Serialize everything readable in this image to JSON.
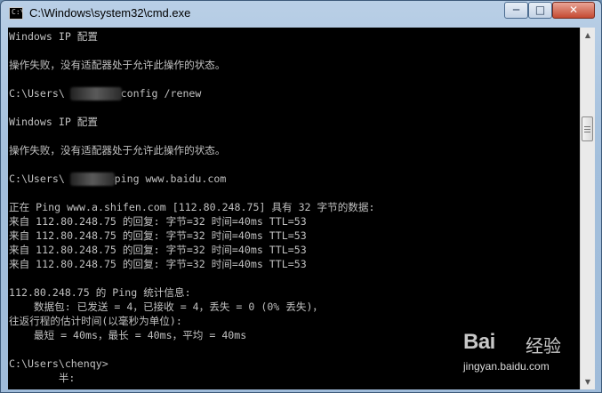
{
  "window": {
    "title": "C:\\Windows\\system32\\cmd.exe",
    "icon_glyph": "C:\\",
    "controls": {
      "minimize": "─",
      "maximize": "□",
      "close": "✕"
    }
  },
  "console": {
    "lines": [
      "Windows IP 配置",
      "",
      "操作失败，没有适配器处于允许此操作的状态。",
      "",
      "C:\\Users\\      >ipconfig /renew",
      "",
      "Windows IP 配置",
      "",
      "操作失败，没有适配器处于允许此操作的状态。",
      "",
      "C:\\Users\\      y>ping www.baidu.com",
      "",
      "正在 Ping www.a.shifen.com [112.80.248.75] 具有 32 字节的数据:",
      "来自 112.80.248.75 的回复: 字节=32 时间=40ms TTL=53",
      "来自 112.80.248.75 的回复: 字节=32 时间=40ms TTL=53",
      "来自 112.80.248.75 的回复: 字节=32 时间=40ms TTL=53",
      "来自 112.80.248.75 的回复: 字节=32 时间=40ms TTL=53",
      "",
      "112.80.248.75 的 Ping 统计信息:",
      "    数据包: 已发送 = 4，已接收 = 4，丢失 = 0 (0% 丢失)，",
      "往返行程的估计时间(以毫秒为单位):",
      "    最短 = 40ms，最长 = 40ms，平均 = 40ms",
      "",
      "C:\\Users\\chenqy>",
      "        半:"
    ]
  },
  "watermark": {
    "logo": "Bai",
    "logo_cn": "经验",
    "url": "jingyan.baidu.com"
  }
}
